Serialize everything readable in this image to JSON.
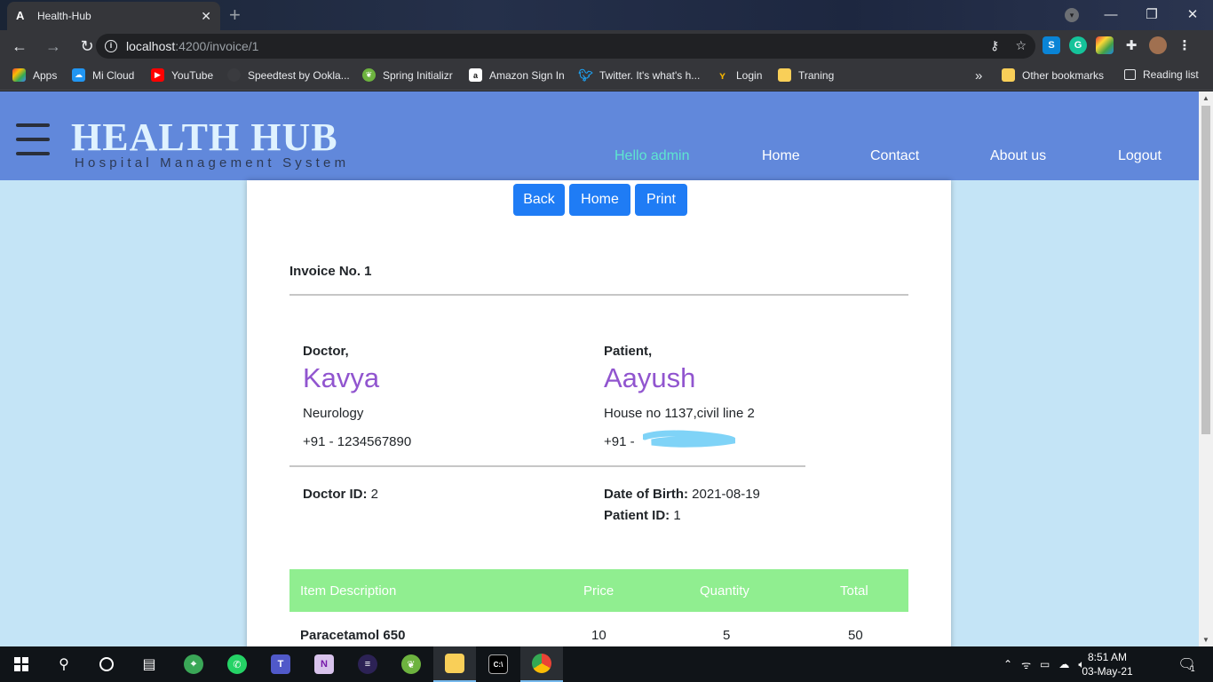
{
  "browser": {
    "tab_title": "Health-Hub",
    "tab_favicon": "A",
    "url_host": "localhost",
    "url_path": ":4200/invoice/1",
    "bookmarks": [
      {
        "label": "Apps",
        "icon": "apps-grid-icon",
        "color": "#ea4335"
      },
      {
        "label": "Mi Cloud",
        "icon": "mi-cloud-icon",
        "color": "#2196f3"
      },
      {
        "label": "YouTube",
        "icon": "youtube-icon",
        "color": "#ff0000"
      },
      {
        "label": "Speedtest by Ookla...",
        "icon": "speedtest-icon",
        "color": "#3a3b3f"
      },
      {
        "label": "Spring Initializr",
        "icon": "spring-icon",
        "color": "#6db33f"
      },
      {
        "label": "Amazon Sign In",
        "icon": "amazon-icon",
        "color": "#ffffff"
      },
      {
        "label": "Twitter. It's what's h...",
        "icon": "twitter-icon",
        "color": "#1da1f2"
      },
      {
        "label": "Login",
        "icon": "login-icon",
        "color": "#f4b400"
      },
      {
        "label": "Traning",
        "icon": "folder-icon",
        "color": "#f9cf58"
      }
    ],
    "overflow_label": "»",
    "other_bookmarks": "Other bookmarks",
    "reading_list": "Reading list"
  },
  "header": {
    "brand": "HEALTH HUB",
    "subtitle": "Hospital Management System",
    "nav": {
      "greeting": "Hello admin",
      "home": "Home",
      "contact": "Contact",
      "about": "About us",
      "logout": "Logout"
    },
    "greeting_color": "#5ee6cf"
  },
  "invoice": {
    "buttons": {
      "back": "Back",
      "home": "Home",
      "print": "Print"
    },
    "title": "Invoice No. 1",
    "doctor": {
      "label": "Doctor,",
      "name": "Kavya",
      "department": "Neurology",
      "phone": "+91 - 1234567890",
      "id_label": "Doctor ID:",
      "id": "2"
    },
    "patient": {
      "label": "Patient,",
      "name": "Aayush",
      "address": "House no 1137,civil line 2",
      "phone_prefix": "+91 -",
      "dob_label": "Date of Birth:",
      "dob": "2021-08-19",
      "id_label": "Patient ID:",
      "id": "1"
    },
    "table": {
      "headers": [
        "Item Description",
        "Price",
        "Quantity",
        "Total"
      ],
      "rows": [
        {
          "item": "Paracetamol 650",
          "price": "10",
          "quantity": "5",
          "total": "50"
        }
      ]
    }
  },
  "taskbar": {
    "time": "8:51 AM",
    "date": "03-May-21",
    "notification_count": "1"
  },
  "colors": {
    "header_bg": "#6188db",
    "page_bg": "#c4e4f6",
    "button_bg": "#1f7cf5",
    "name_purple": "#9155cf",
    "table_head_bg": "#90ee90"
  }
}
